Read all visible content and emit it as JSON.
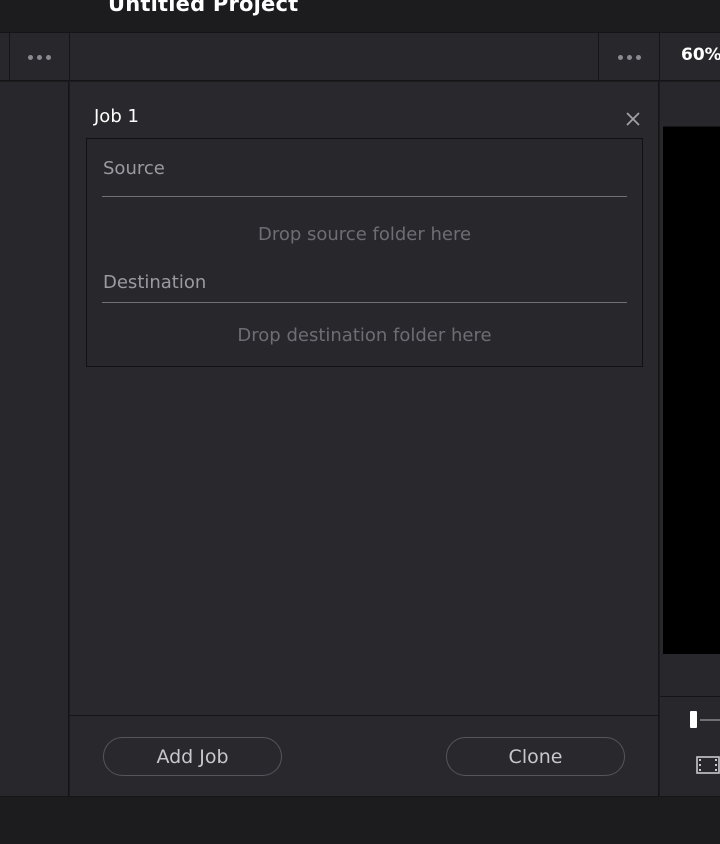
{
  "app": {
    "title": "Untitled Project"
  },
  "toolbar": {
    "left_more_icon": "more-horizontal-icon",
    "right_more_icon": "more-horizontal-icon",
    "zoom_label": "60%"
  },
  "job": {
    "title": "Job 1",
    "close_icon": "close-icon",
    "source": {
      "label": "Source",
      "drop_text": "Drop source folder here"
    },
    "destination": {
      "label": "Destination",
      "drop_text": "Drop destination folder here"
    }
  },
  "footer": {
    "add_job_label": "Add Job",
    "clone_label": "Clone"
  },
  "viewer": {
    "filmstrip_icon": "filmstrip-icon"
  },
  "colors": {
    "panel_bg": "#28282d",
    "app_bg": "#1c1c1f",
    "text_primary": "#ffffff",
    "text_muted": "#9a9aa0",
    "viewer_bg": "#000000"
  }
}
